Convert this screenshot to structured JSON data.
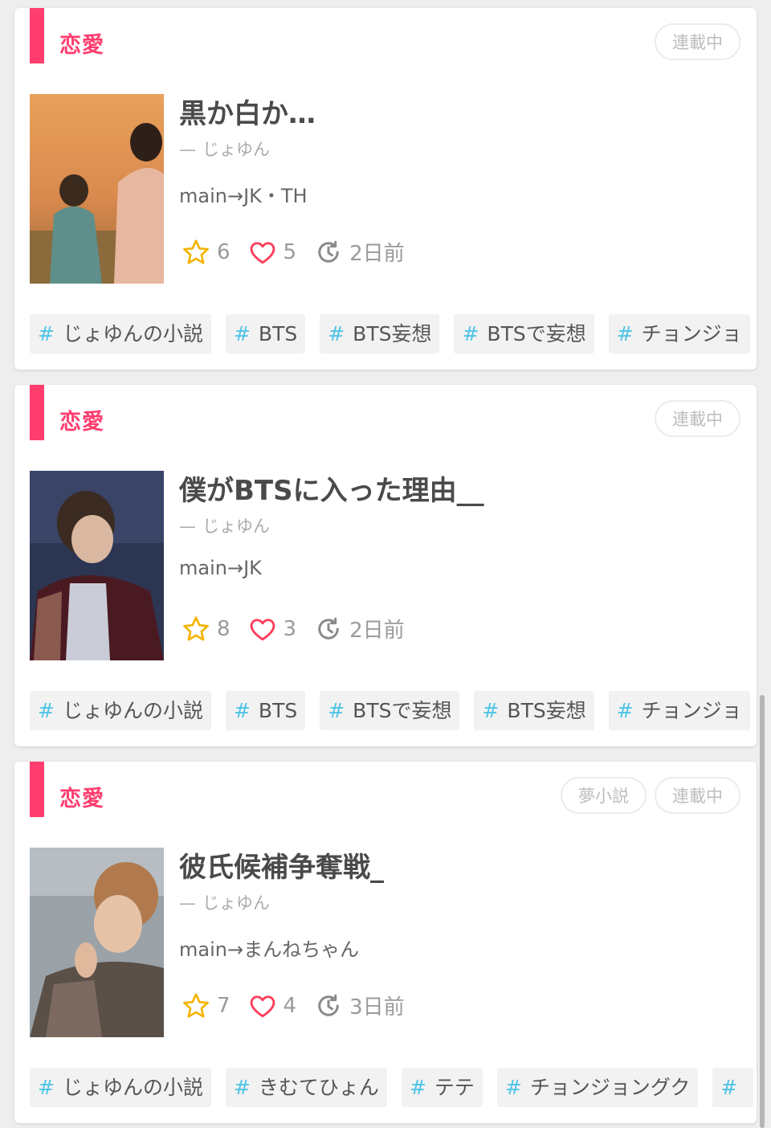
{
  "colors": {
    "accent": "#ff3d6e",
    "hash": "#4fc4e6",
    "star": "#f5b400",
    "heart": "#ff3d5a"
  },
  "cards": [
    {
      "category": "恋愛",
      "badges": [
        "連載中"
      ],
      "title": "黒か白か…",
      "author_dash": "—",
      "author": "じょゆん",
      "description": "main→JK・TH",
      "stars": "6",
      "likes": "5",
      "updated": "2日前",
      "tags": [
        "じょゆんの小説",
        "BTS",
        "BTS妄想",
        "BTSで妄想",
        "チョンジョ"
      ],
      "thumbnail": "sunset-two-people"
    },
    {
      "category": "恋愛",
      "badges": [
        "連載中"
      ],
      "title": "僕がBTSに入った理由__",
      "author_dash": "—",
      "author": "じょゆん",
      "description": "main→JK",
      "stars": "8",
      "likes": "3",
      "updated": "2日前",
      "tags": [
        "じょゆんの小説",
        "BTS",
        "BTSで妄想",
        "BTS妄想",
        "チョンジョ"
      ],
      "thumbnail": "portrait-dark-jacket"
    },
    {
      "category": "恋愛",
      "badges": [
        "夢小説",
        "連載中"
      ],
      "title": "彼氏候補争奪戦_",
      "author_dash": "—",
      "author": "じょゆん",
      "description": "main→まんねちゃん",
      "stars": "7",
      "likes": "4",
      "updated": "3日前",
      "tags": [
        "じょゆんの小説",
        "きむてひょん",
        "テテ",
        "チョンジョングク",
        ""
      ],
      "thumbnail": "portrait-plaid-shirt"
    }
  ]
}
